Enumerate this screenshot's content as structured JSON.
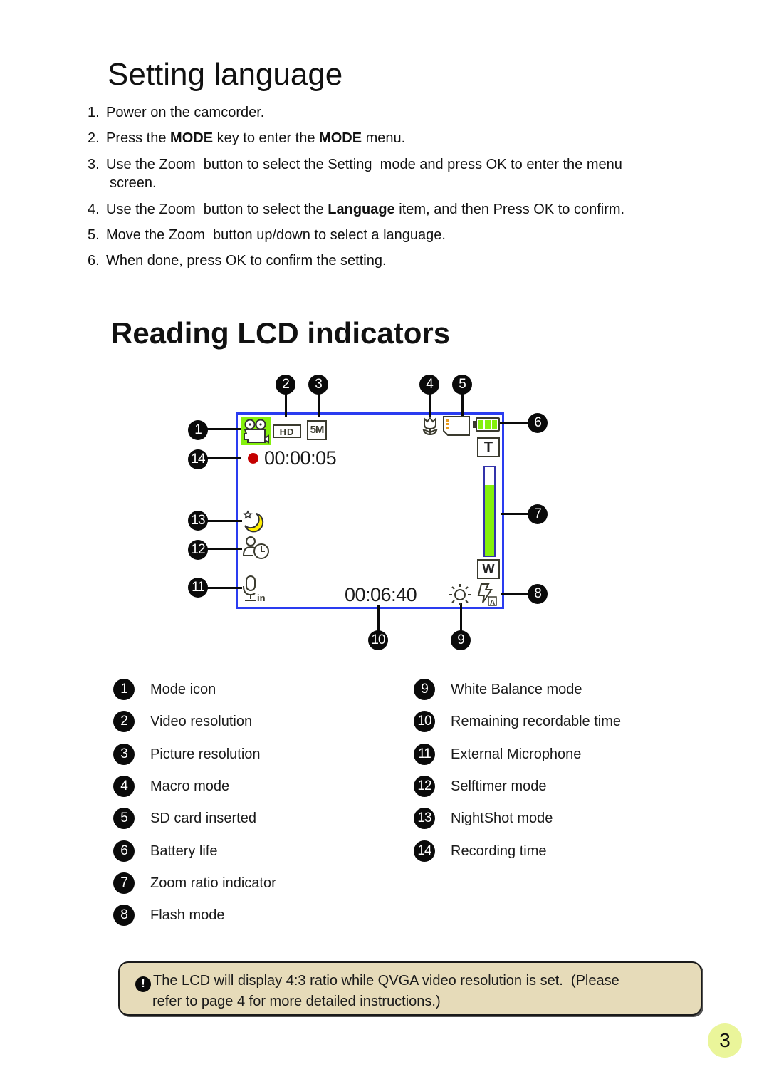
{
  "section1": {
    "title": "Setting language",
    "steps": [
      {
        "num": "1.",
        "parts": [
          "Power on the camcorder."
        ]
      },
      {
        "num": "2.",
        "pre": "Press the ",
        "b1": "MODE",
        "mid": " key to enter the ",
        "b2": "MODE",
        "post": " menu."
      },
      {
        "num": "3.",
        "line1": "Use the Zoom  button to select the Setting  mode and press OK to enter the menu",
        "line2": "screen."
      },
      {
        "num": "4.",
        "pre": "Use the Zoom  button to select the ",
        "b1": "Language",
        "post": " item, and then Press OK to confirm."
      },
      {
        "num": "5.",
        "text": "Move the Zoom  button up/down to select a language."
      },
      {
        "num": "6.",
        "text": "When done, press OK to confirm the setting."
      }
    ]
  },
  "section2": {
    "title": "Reading LCD indicators"
  },
  "lcd": {
    "frame_color": "#2a3cf0",
    "recording_time": "00:00:05",
    "remaining_time": "00:06:40",
    "video_resolution_badge": "HD",
    "picture_resolution_badge": "5M",
    "zoom_tele_label": "T",
    "zoom_wide_label": "W",
    "zoom_level_fraction": 0.8,
    "battery_bars": 3,
    "accent_green": "#84f00c",
    "record_dot_color": "#c40000",
    "callouts": [
      "1",
      "2",
      "3",
      "4",
      "5",
      "6",
      "7",
      "8",
      "9",
      "10",
      "11",
      "12",
      "13",
      "14"
    ]
  },
  "legend": {
    "left": [
      {
        "num": "1",
        "label": "Mode icon"
      },
      {
        "num": "2",
        "label": "Video resolution"
      },
      {
        "num": "3",
        "label": "Picture resolution"
      },
      {
        "num": "4",
        "label": "Macro mode"
      },
      {
        "num": "5",
        "label": "SD card inserted"
      },
      {
        "num": "6",
        "label": "Battery life"
      },
      {
        "num": "7",
        "label": "Zoom ratio indicator"
      },
      {
        "num": "8",
        "label": "Flash mode"
      }
    ],
    "right": [
      {
        "num": "9",
        "label": "White Balance mode"
      },
      {
        "num": "10",
        "label": "Remaining recordable time"
      },
      {
        "num": "11",
        "label": "External Microphone"
      },
      {
        "num": "12",
        "label": "Selftimer mode"
      },
      {
        "num": "13",
        "label": "NightShot mode"
      },
      {
        "num": "14",
        "label": "Recording time"
      }
    ]
  },
  "note": {
    "icon": "!",
    "line1": "The LCD will display 4:3 ratio while QVGA video resolution is set.  (Please",
    "line2": "refer to page 4 for more detailed instructions.)",
    "background": "#e6dbb9"
  },
  "page_number": "3"
}
